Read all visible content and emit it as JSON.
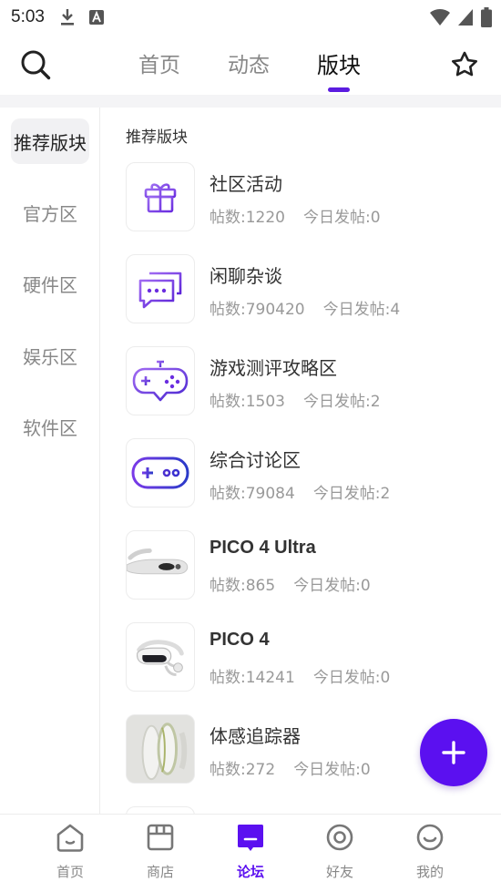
{
  "status_bar": {
    "time": "5:03",
    "icons": [
      "download-icon",
      "a-box-icon",
      "wifi-icon",
      "signal-icon",
      "battery-icon"
    ]
  },
  "top_nav": {
    "tabs": [
      {
        "label": "首页"
      },
      {
        "label": "动态"
      },
      {
        "label": "版块",
        "active": true
      }
    ],
    "accent": "#5b1ce0"
  },
  "sidebar": {
    "items": [
      {
        "label": "推荐版块",
        "active": true
      },
      {
        "label": "官方区"
      },
      {
        "label": "硬件区"
      },
      {
        "label": "娱乐区"
      },
      {
        "label": "软件区"
      }
    ]
  },
  "main": {
    "section_title": "推荐版块",
    "boards": [
      {
        "name": "社区活动",
        "posts": "帖数:1220",
        "today": "今日发帖:0",
        "icon": "gift-icon"
      },
      {
        "name": "闲聊杂谈",
        "posts": "帖数:790420",
        "today": "今日发帖:4",
        "icon": "chat-bubbles-icon"
      },
      {
        "name": "游戏测评攻略区",
        "posts": "帖数:1503",
        "today": "今日发帖:2",
        "icon": "gamepad-chat-icon"
      },
      {
        "name": "综合讨论区",
        "posts": "帖数:79084",
        "today": "今日发帖:2",
        "icon": "gamepad-icon"
      },
      {
        "name": "PICO 4 Ultra",
        "posts": "帖数:865",
        "today": "今日发帖:0",
        "icon": "vr-headset-image"
      },
      {
        "name": "PICO 4",
        "posts": "帖数:14241",
        "today": "今日发帖:0",
        "icon": "vr-headset-image"
      },
      {
        "name": "体感追踪器",
        "posts": "帖数:272",
        "today": "今日发帖:0",
        "icon": "tracker-image"
      }
    ]
  },
  "fab": {
    "icon": "plus-icon",
    "color": "#5b10f0"
  },
  "bottom_nav": {
    "items": [
      {
        "label": "首页",
        "icon": "home-icon"
      },
      {
        "label": "商店",
        "icon": "store-icon"
      },
      {
        "label": "论坛",
        "icon": "forum-icon",
        "active": true
      },
      {
        "label": "好友",
        "icon": "friends-icon"
      },
      {
        "label": "我的",
        "icon": "profile-icon"
      }
    ]
  }
}
